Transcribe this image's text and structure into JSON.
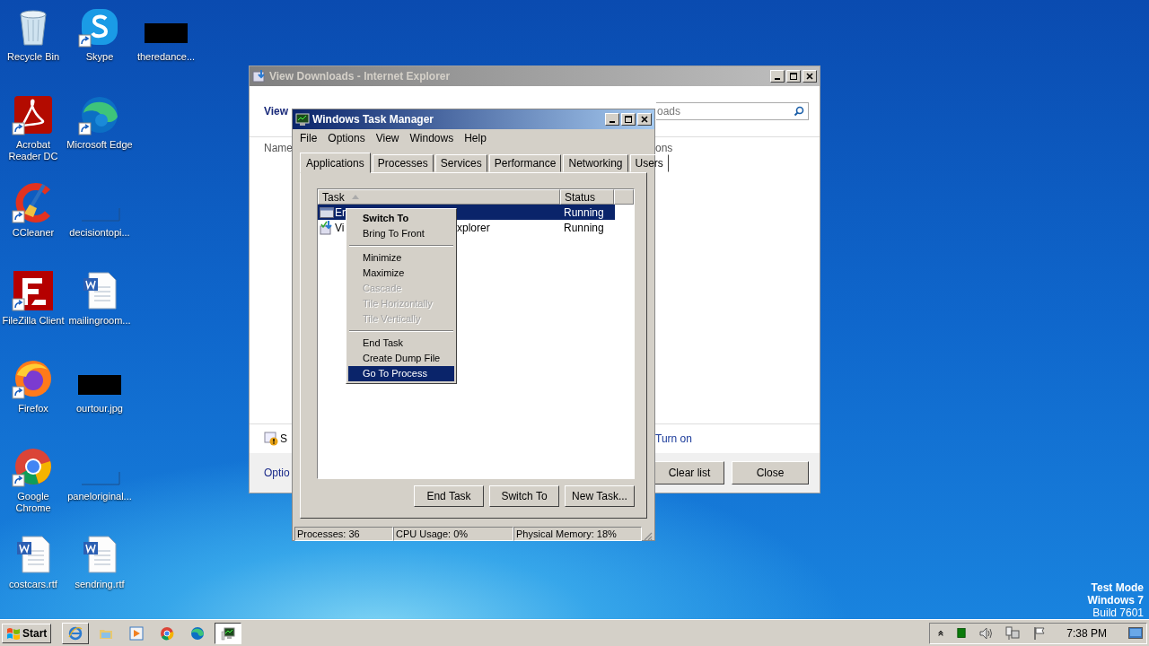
{
  "desktop_icons": [
    {
      "label": "Recycle Bin",
      "kind": "recycle",
      "shortcut": false
    },
    {
      "label": "Acrobat Reader DC",
      "kind": "acrobat",
      "shortcut": true
    },
    {
      "label": "CCleaner",
      "kind": "ccleaner",
      "shortcut": true
    },
    {
      "label": "FileZilla Client",
      "kind": "filezilla",
      "shortcut": true
    },
    {
      "label": "Firefox",
      "kind": "firefox",
      "shortcut": true
    },
    {
      "label": "Google Chrome",
      "kind": "chrome",
      "shortcut": true
    },
    {
      "label": "costcars.rtf",
      "kind": "word",
      "shortcut": false
    },
    {
      "label": "Skype",
      "kind": "skype",
      "shortcut": true
    },
    {
      "label": "Microsoft Edge",
      "kind": "edge",
      "shortcut": true
    },
    {
      "label": "decisiontopi...",
      "kind": "blank",
      "shortcut": false
    },
    {
      "label": "mailingroom...",
      "kind": "word",
      "shortcut": false
    },
    {
      "label": "ourtour.jpg",
      "kind": "black",
      "shortcut": false
    },
    {
      "label": "paneloriginal...",
      "kind": "blank",
      "shortcut": false
    },
    {
      "label": "sendring.rtf",
      "kind": "word",
      "shortcut": false
    },
    {
      "label": "theredance...",
      "kind": "black",
      "shortcut": false
    }
  ],
  "system_notice": [
    {
      "text": "Test Mode",
      "bold": true
    },
    {
      "text": "Windows 7",
      "bold": true
    },
    {
      "text": "Build 7601",
      "bold": false
    }
  ],
  "ie_window": {
    "title": "View Downloads - Internet Explorer",
    "active": false,
    "heading": "View",
    "search": {
      "placeholder": "oads"
    },
    "column_1": "Name",
    "column_2": "ons",
    "notice": "S",
    "notice_link": "Turn on",
    "options_link": "Optio",
    "buttons": [
      "Clear list",
      "Close"
    ]
  },
  "task_manager": {
    "title": "Windows Task Manager",
    "active": true,
    "menu": [
      "File",
      "Options",
      "View",
      "Windows",
      "Help"
    ],
    "tabs": [
      {
        "label": "Applications",
        "selected": true
      },
      {
        "label": "Processes",
        "selected": false
      },
      {
        "label": "Services",
        "selected": false
      },
      {
        "label": "Performance",
        "selected": false
      },
      {
        "label": "Networking",
        "selected": false
      },
      {
        "label": "Users",
        "selected": false
      }
    ],
    "columns": [
      "Task",
      "Status"
    ],
    "rows": [
      {
        "kind": "window",
        "name": "Er",
        "status": "Running",
        "selected": true
      },
      {
        "kind": "download",
        "name": "Vi",
        "tail": "xplorer",
        "status": "Running",
        "selected": false
      }
    ],
    "buttons": [
      "End Task",
      "Switch To",
      "New Task..."
    ],
    "status": [
      "Processes: 36",
      "CPU Usage: 0%",
      "Physical Memory: 18%"
    ]
  },
  "context_menu": {
    "items": [
      {
        "kind": "item",
        "label": "Switch To",
        "default": true,
        "disabled": false,
        "selected": false
      },
      {
        "kind": "item",
        "label": "Bring To Front",
        "default": false,
        "disabled": false,
        "selected": false
      },
      {
        "kind": "separator"
      },
      {
        "kind": "item",
        "label": "Minimize",
        "default": false,
        "disabled": false,
        "selected": false
      },
      {
        "kind": "item",
        "label": "Maximize",
        "default": false,
        "disabled": false,
        "selected": false
      },
      {
        "kind": "item",
        "label": "Cascade",
        "default": false,
        "disabled": true,
        "selected": false
      },
      {
        "kind": "item",
        "label": "Tile Horizontally",
        "default": false,
        "disabled": true,
        "selected": false
      },
      {
        "kind": "item",
        "label": "Tile Vertically",
        "default": false,
        "disabled": true,
        "selected": false
      },
      {
        "kind": "separator"
      },
      {
        "kind": "item",
        "label": "End Task",
        "default": false,
        "disabled": false,
        "selected": false
      },
      {
        "kind": "item",
        "label": "Create Dump File",
        "default": false,
        "disabled": false,
        "selected": false
      },
      {
        "kind": "item",
        "label": "Go To Process",
        "default": false,
        "disabled": false,
        "selected": true
      }
    ]
  },
  "taskbar": {
    "start": "Start",
    "buttons": [
      {
        "kind": "ie",
        "active": false
      },
      {
        "kind": "folder",
        "active": false
      },
      {
        "kind": "media",
        "active": false
      },
      {
        "kind": "chrome",
        "active": false
      },
      {
        "kind": "edge",
        "active": false
      },
      {
        "kind": "taskmgr",
        "active": true
      }
    ],
    "clock": "7:38 PM"
  }
}
